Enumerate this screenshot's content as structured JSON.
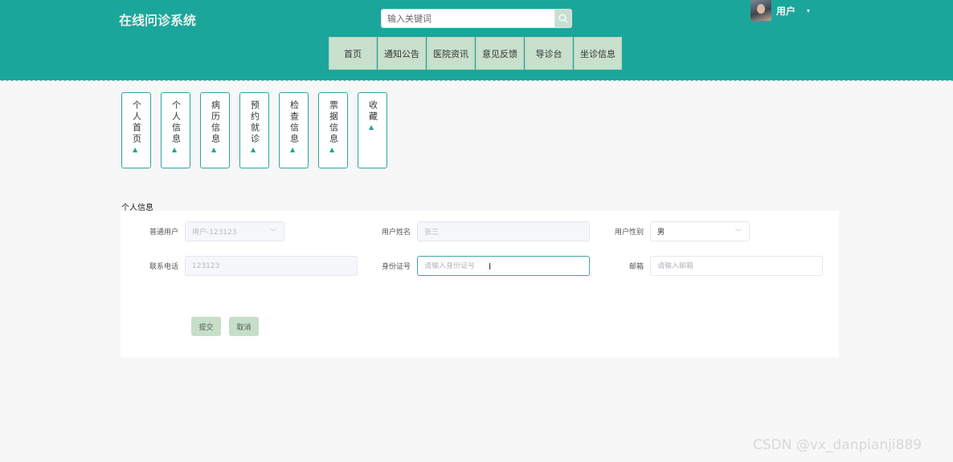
{
  "header": {
    "site_title": "在线问诊系统",
    "search": {
      "placeholder": "输入关键词",
      "icon": "search-icon"
    },
    "user": {
      "name": "用户",
      "caret": "▾"
    }
  },
  "nav": {
    "items": [
      {
        "label": "首页"
      },
      {
        "label": "通知公告"
      },
      {
        "label": "医院资讯"
      },
      {
        "label": "意见反馈"
      },
      {
        "label": "导诊台"
      },
      {
        "label": "坐诊信息"
      }
    ]
  },
  "side_cards": [
    {
      "label": "个人首页"
    },
    {
      "label": "个人信息"
    },
    {
      "label": "病历信息"
    },
    {
      "label": "预约就诊"
    },
    {
      "label": "检查信息"
    },
    {
      "label": "票据信息"
    },
    {
      "label": "收藏"
    }
  ],
  "form": {
    "section_title": "个人信息",
    "fields": {
      "user_type": {
        "label": "普通用户",
        "value": "用户-123123"
      },
      "user_name": {
        "label": "用户姓名",
        "value": "张三"
      },
      "gender": {
        "label": "用户性别",
        "value": "男"
      },
      "phone": {
        "label": "联系电话",
        "value": "123123"
      },
      "id_number": {
        "label": "身份证号",
        "placeholder": "请输入身份证号"
      },
      "email": {
        "label": "邮箱",
        "placeholder": "请输入邮箱"
      }
    },
    "buttons": {
      "submit": "提交",
      "cancel": "取消"
    }
  },
  "watermark": "CSDN @vx_danpianji889",
  "colors": {
    "primary": "#1ba69c",
    "nav_bg": "#c8e0cc",
    "button_bg": "#c6dfc8"
  }
}
